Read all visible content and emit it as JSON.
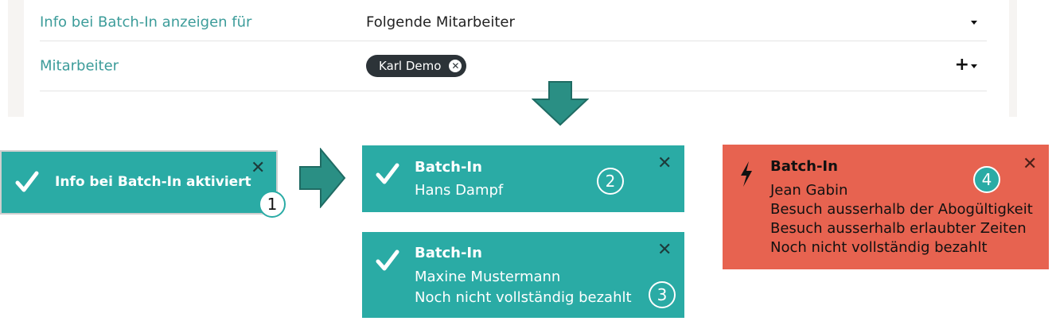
{
  "settings": {
    "row1": {
      "label": "Info bei Batch-In anzeigen für",
      "value": "Folgende Mitarbeiter"
    },
    "row2": {
      "label": "Mitarbeiter",
      "chip": "Karl Demo",
      "add": "+"
    }
  },
  "toasts": [
    {
      "id": 1,
      "color": "#2aaba5",
      "icon": "check-icon",
      "title": "Info bei Batch-In aktiviert",
      "lines": [],
      "badge": "1"
    },
    {
      "id": 2,
      "color": "#2aaba5",
      "icon": "check-icon",
      "title": "Batch-In",
      "lines": [
        "Hans Dampf"
      ],
      "badge": "2"
    },
    {
      "id": 3,
      "color": "#2aaba5",
      "icon": "check-icon",
      "title": "Batch-In",
      "lines": [
        "Maxine Mustermann",
        "Noch nicht vollständig bezahlt"
      ],
      "badge": "3"
    },
    {
      "id": 4,
      "color": "#e76350",
      "icon": "lightning-icon",
      "title": "Batch-In",
      "lines": [
        "Jean Gabin",
        "Besuch ausserhalb der Abogültigkeit",
        "Besuch ausserhalb erlaubter Zeiten",
        "Noch nicht vollständig bezahlt"
      ],
      "badge": "4"
    }
  ],
  "close_glyph": "✕",
  "arrow_color": "#2a8f84"
}
